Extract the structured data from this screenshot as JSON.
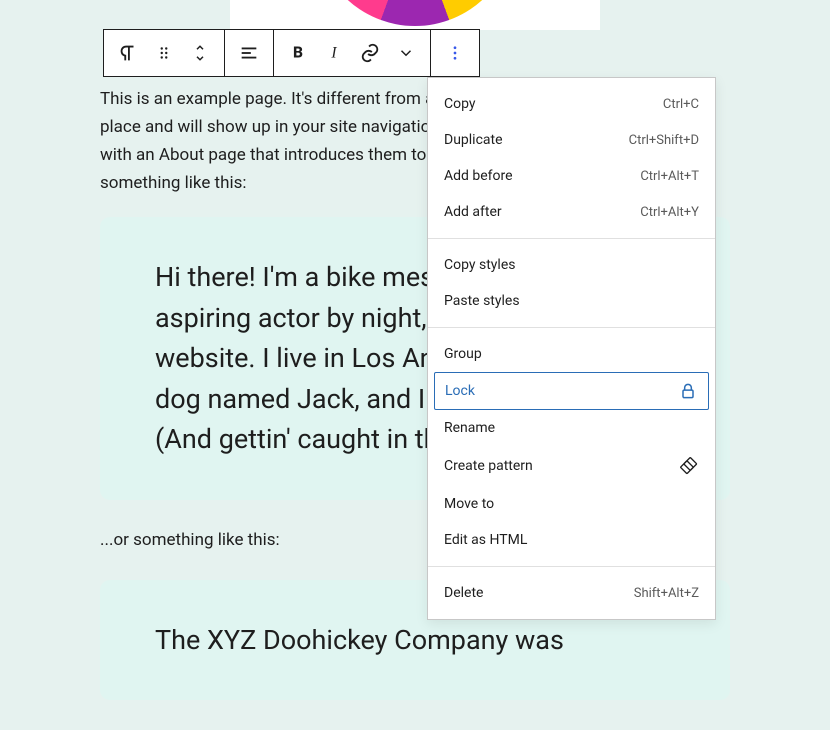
{
  "toolbar": {
    "block_type": "paragraph",
    "drag": "drag-handle",
    "move": "move-updown",
    "align": "align-left",
    "bold": "B",
    "italic": "I",
    "link": "link",
    "dropdown": "chevron",
    "more": "more-vertical"
  },
  "content": {
    "paragraph1": "This is an example page. It's different from a blog post because it will stay in one place and will show up in your site navigation (in most themes). Most people start with an About page that introduces them to potential site visitors. It says something like this:",
    "quote1": "Hi there! I'm a bike messenger by day, aspiring actor by night, and this is my website. I live in Los Angeles, have a great dog named Jack, and I like piña coladas. (And gettin' caught in the rain.)",
    "interlude": "...or something like this:",
    "quote2": "The XYZ Doohickey Company was"
  },
  "menu": {
    "sections": [
      {
        "items": [
          {
            "label": "Copy",
            "shortcut": "Ctrl+C"
          },
          {
            "label": "Duplicate",
            "shortcut": "Ctrl+Shift+D"
          },
          {
            "label": "Add before",
            "shortcut": "Ctrl+Alt+T"
          },
          {
            "label": "Add after",
            "shortcut": "Ctrl+Alt+Y"
          }
        ]
      },
      {
        "items": [
          {
            "label": "Copy styles"
          },
          {
            "label": "Paste styles"
          }
        ]
      },
      {
        "items": [
          {
            "label": "Group"
          },
          {
            "label": "Lock",
            "icon": "lock",
            "selected": true
          },
          {
            "label": "Rename"
          },
          {
            "label": "Create pattern",
            "icon": "pattern"
          },
          {
            "label": "Move to"
          },
          {
            "label": "Edit as HTML"
          }
        ]
      },
      {
        "items": [
          {
            "label": "Delete",
            "shortcut": "Shift+Alt+Z"
          }
        ]
      }
    ]
  }
}
